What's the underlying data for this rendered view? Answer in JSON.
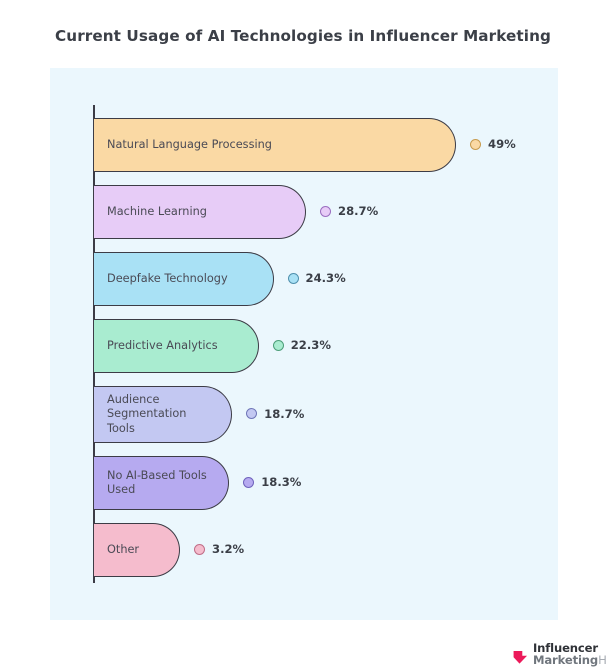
{
  "chart_data": {
    "type": "bar",
    "orientation": "horizontal",
    "title": "Current Usage of AI Technologies in Influencer Marketing",
    "xlabel": "",
    "ylabel": "",
    "grid": false,
    "legend_position": "inline-right",
    "xlim": [
      0,
      49
    ],
    "categories": [
      "Natural Language Processing",
      "Machine Learning",
      "Deepfake Technology",
      "Predictive Analytics",
      "Audience Segmentation Tools",
      "No AI-Based Tools Used",
      "Other"
    ],
    "values": [
      49,
      28.7,
      24.3,
      22.3,
      18.7,
      18.3,
      3.2
    ],
    "value_labels": [
      "49%",
      "28.7%",
      "24.3%",
      "22.3%",
      "18.7%",
      "18.3%",
      "3.2%"
    ],
    "colors": [
      "#fad9a4",
      "#e7ccf7",
      "#a9e1f5",
      "#a9ecd0",
      "#c3c8f2",
      "#b6aaf0",
      "#f5bccd"
    ],
    "bars": [
      {
        "label": "Natural Language Processing",
        "value": 49,
        "value_label": "49%",
        "color": "#fad9a4",
        "dot_border": "#c79b4e"
      },
      {
        "label": "Machine Learning",
        "value": 28.7,
        "value_label": "28.7%",
        "color": "#e7ccf7",
        "dot_border": "#9a6ec0"
      },
      {
        "label": "Deepfake Technology",
        "value": 24.3,
        "value_label": "24.3%",
        "color": "#a9e1f5",
        "dot_border": "#4f90ad"
      },
      {
        "label": "Predictive Analytics",
        "value": 22.3,
        "value_label": "22.3%",
        "color": "#a9ecd0",
        "dot_border": "#4c9e79"
      },
      {
        "label": "Audience Segmentation\nTools",
        "value": 18.7,
        "value_label": "18.7%",
        "color": "#c3c8f2",
        "dot_border": "#6f75b8"
      },
      {
        "label": "No AI-Based Tools Used",
        "value": 18.3,
        "value_label": "18.3%",
        "color": "#b6aaf0",
        "dot_border": "#6f63bd"
      },
      {
        "label": "Other",
        "value": 3.2,
        "value_label": "3.2%",
        "color": "#f5bccd",
        "dot_border": "#c06e88"
      }
    ]
  },
  "panel": {
    "background": "#ebf7fd",
    "axis_color": "#3c3c46",
    "bar_border_color": "#3c3c46"
  },
  "logo": {
    "line1": "Influencer",
    "marketing": "Marketing",
    "hub": "Hub",
    "mark_color": "#ec1a5a"
  }
}
